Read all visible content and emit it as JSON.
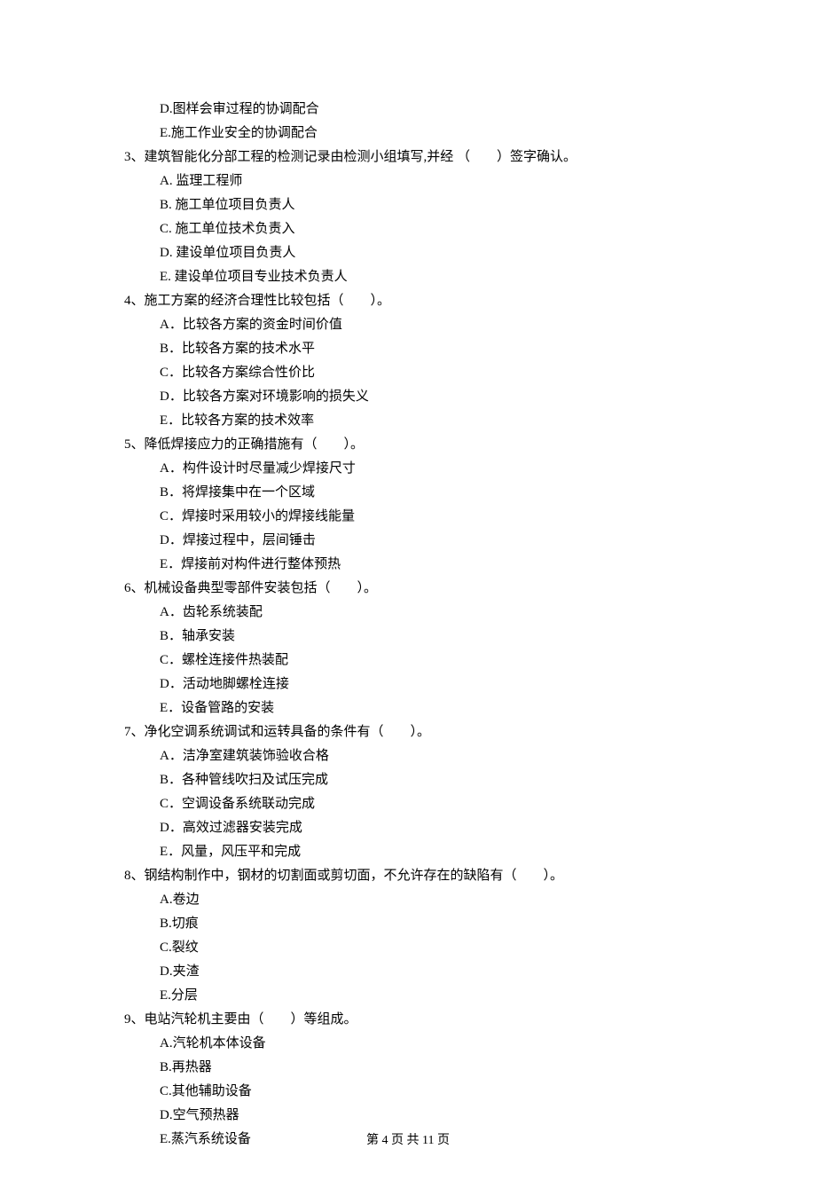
{
  "extra_options": [
    "D.图样会审过程的协调配合",
    "E.施工作业安全的协调配合"
  ],
  "questions": [
    {
      "num": "3、",
      "stem": "建筑智能化分部工程的检测记录由检测小组填写,并经 （　　）签字确认。",
      "options": [
        "A. 监理工程师",
        "B. 施工单位项目负责人",
        "C. 施工单位技术负责入",
        "D. 建设单位项目负责人",
        "E. 建设单位项目专业技术负责人"
      ]
    },
    {
      "num": "4、",
      "stem": "施工方案的经济合理性比较包括（　　）。",
      "options": [
        "A．比较各方案的资金时间价值",
        "B．比较各方案的技术水平",
        "C．比较各方案综合性价比",
        "D．比较各方案对环境影响的损失义",
        "E．比较各方案的技术效率"
      ]
    },
    {
      "num": "5、",
      "stem": "降低焊接应力的正确措施有（　　）。",
      "options": [
        "A．构件设计时尽量减少焊接尺寸",
        "B．将焊接集中在一个区域",
        "C．焊接时采用较小的焊接线能量",
        "D．焊接过程中，层间锤击",
        "E．焊接前对构件进行整体预热"
      ]
    },
    {
      "num": "6、",
      "stem": "机械设备典型零部件安装包括（　　）。",
      "options": [
        "A．齿轮系统装配",
        "B．轴承安装",
        "C．螺栓连接件热装配",
        "D．活动地脚螺栓连接",
        "E．设备管路的安装"
      ]
    },
    {
      "num": "7、",
      "stem": "净化空调系统调试和运转具备的条件有（　　）。",
      "options": [
        "A．洁净室建筑装饰验收合格",
        "B．各种管线吹扫及试压完成",
        "C．空调设备系统联动完成",
        "D．高效过滤器安装完成",
        "E．风量，风压平和完成"
      ]
    },
    {
      "num": "8、",
      "stem": "钢结构制作中，钢材的切割面或剪切面，不允许存在的缺陷有（　　）。",
      "options": [
        "A.卷边",
        "B.切痕",
        "C.裂纹",
        "D.夹渣",
        "E.分层"
      ]
    },
    {
      "num": "9、",
      "stem": "电站汽轮机主要由（　　）等组成。",
      "options": [
        "A.汽轮机本体设备",
        "B.再热器",
        "C.其他辅助设备",
        "D.空气预热器",
        "E.蒸汽系统设备"
      ]
    }
  ],
  "footer": "第 4 页 共 11 页"
}
